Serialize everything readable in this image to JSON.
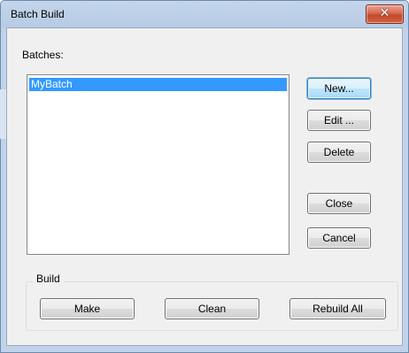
{
  "window": {
    "title": "Batch Build",
    "close_glyph": "✕"
  },
  "batches": {
    "label": "Batches:",
    "items": [
      "MyBatch"
    ],
    "selected_index": 0
  },
  "buttons": {
    "new": "New...",
    "edit": "Edit ...",
    "delete": "Delete",
    "close": "Close",
    "cancel": "Cancel"
  },
  "build": {
    "label": "Build",
    "make": "Make",
    "clean": "Clean",
    "rebuild_all": "Rebuild All"
  },
  "colors": {
    "selection": "#3399ff",
    "close_button": "#c24a2e",
    "default_button_border": "#3c7fb1"
  }
}
